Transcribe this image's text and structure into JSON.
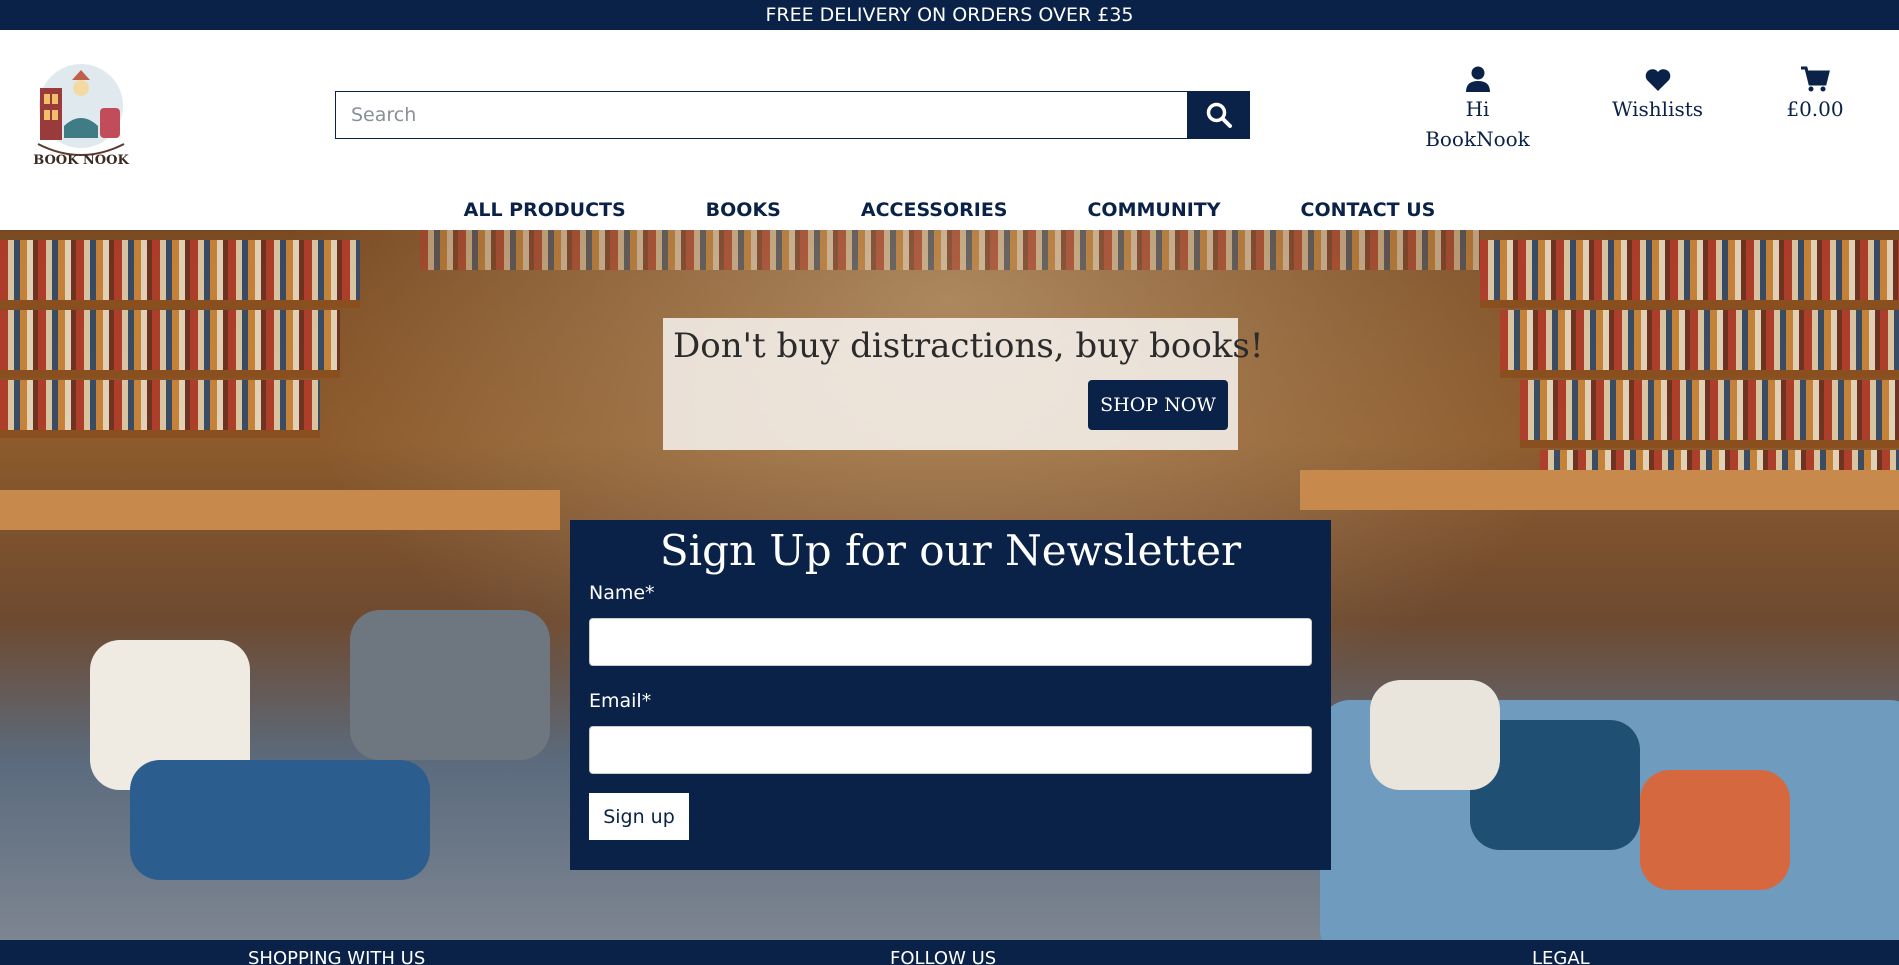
{
  "banner": {
    "text": "FREE DELIVERY ON ORDERS OVER £35"
  },
  "brand": {
    "logo_text": "BOOK NOOK"
  },
  "search": {
    "placeholder": "Search"
  },
  "header": {
    "account_line1": "Hi",
    "account_line2": "BookNook",
    "wishlists": "Wishlists",
    "cart_total": "£0.00"
  },
  "nav": [
    "ALL PRODUCTS",
    "BOOKS",
    "ACCESSORIES",
    "COMMUNITY",
    "CONTACT US"
  ],
  "hero": {
    "tagline": "Don't buy distractions, buy books!",
    "cta": "SHOP NOW"
  },
  "newsletter": {
    "title": "Sign Up for our Newsletter",
    "name_label": "Name*",
    "email_label": "Email*",
    "submit": "Sign up"
  },
  "footer": {
    "columns": [
      "SHOPPING WITH US",
      "FOLLOW US",
      "LEGAL"
    ]
  },
  "colors": {
    "navy": "#0a2248",
    "white": "#ffffff"
  }
}
